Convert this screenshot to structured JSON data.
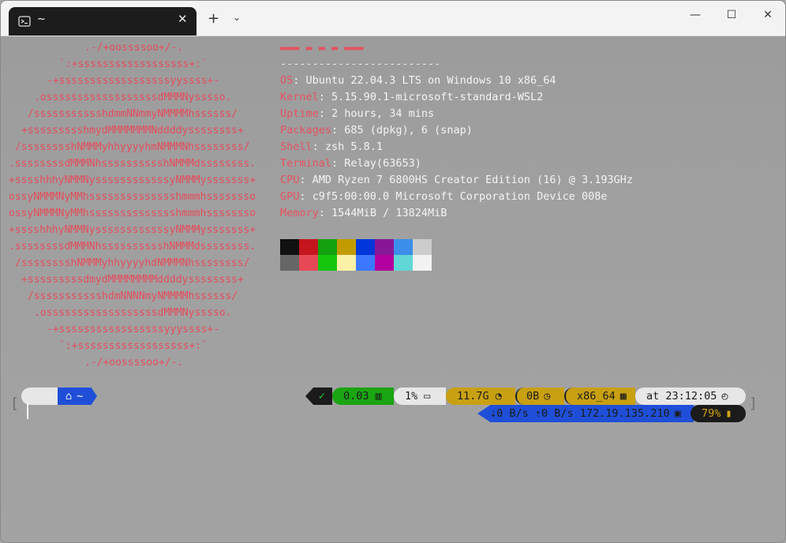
{
  "tab": {
    "title": "~",
    "close": "✕"
  },
  "titlebar": {
    "new_tab": "+",
    "dropdown": "⌄",
    "minimize": "—",
    "maximize": "☐",
    "close": "✕"
  },
  "logo_lines": [
    ".-/+oossssoo+/-.",
    "`:+ssssssssssssssssss+:`",
    "-+ssssssssssssssssssyyssss+-",
    ".ossssssssssssssssssdMMMNysssso.",
    "/ssssssssssshdmmNNmmyNMMMMhssssss/",
    "+ssssssssshmydMMMMMMMNddddyssssssss+",
    "/sssssssshNMMMyhhyyyyhmNMMMNhssssssss/",
    ".ssssssssdMMMNhsssssssssshNMMMdssssssss.",
    "+sssshhhyNMMNyssssssssssssyNMMMysssssss+",
    "ossyNMMMNyMMhsssssssssssssshmmmhssssssso",
    "ossyNMMMNyMMhsssssssssssssshmmmhssssssso",
    "+sssshhhyNMMNyssssssssssssyNMMMysssssss+",
    ".ssssssssdMMMNhsssssssssshNMMMdssssssss.",
    "/sssssssshNMMMyhhyyyyhdNMMMNhssssssss/",
    "+sssssssssdmydMMMMMMMMddddyssssssss+",
    "/ssssssssssshdmNNNNmyNMMMMhssssss/",
    ".ossssssssssssssssssdMMMNysssso.",
    "-+sssssssssssssssssyyyssss+-",
    "`:+ssssssssssssssssss+:`",
    ".-/+oossssoo+/-."
  ],
  "user_host": "▬▬▬ ▬ ▬ ▬   ▬▬▬",
  "separator": "-------------------------",
  "info": [
    {
      "key": "OS",
      "value": "Ubuntu 22.04.3 LTS on Windows 10 x86_64"
    },
    {
      "key": "Kernel",
      "value": "5.15.90.1-microsoft-standard-WSL2"
    },
    {
      "key": "Uptime",
      "value": "2 hours, 34 mins"
    },
    {
      "key": "Packages",
      "value": "685 (dpkg), 6 (snap)"
    },
    {
      "key": "Shell",
      "value": "zsh 5.8.1"
    },
    {
      "key": "Terminal",
      "value": "Relay(63653)"
    },
    {
      "key": "CPU",
      "value": "AMD Ryzen 7 6800HS Creator Edition (16) @ 3.193GHz"
    },
    {
      "key": "GPU",
      "value": "c9f5:00:00.0 Microsoft Corporation Device 008e"
    },
    {
      "key": "Memory",
      "value": "1544MiB / 13824MiB"
    }
  ],
  "palette_row1": [
    "#111111",
    "#c4161c",
    "#13a10e",
    "#c19c00",
    "#0037da",
    "#881798",
    "#3b8eea",
    "#cccccc"
  ],
  "palette_row2": [
    "#666666",
    "#e74856",
    "#16c60c",
    "#f9f1a5",
    "#3b78ff",
    "#b4009e",
    "#61d6d6",
    "#f2f2f2"
  ],
  "prompt": {
    "os_icon": "",
    "dir_icon": "⌂",
    "dir": "~",
    "status_ok": "✓",
    "load": "0.03",
    "load_icon": "▥",
    "disk": "1%",
    "disk_icon": "▭",
    "ram": "11.7G",
    "ram_icon": "◔",
    "swap": "0B",
    "swap_icon": "◷",
    "arch": "x86_64",
    "arch_icon": "▦",
    "time": "at 23:12:05",
    "time_icon": "◴",
    "net": "⇣0 B/s ⇡0 B/s 172.19.135.210",
    "net_icon": "▣",
    "battery": "79%",
    "battery_icon": "▮"
  },
  "colors": {
    "accent_red": "#e44d5b",
    "pill_green": "#1aa512",
    "pill_gold": "#c9a012",
    "pill_blue": "#1f4fd8",
    "pill_light": "#e7e7e7",
    "pill_black": "#1b1b1b"
  }
}
